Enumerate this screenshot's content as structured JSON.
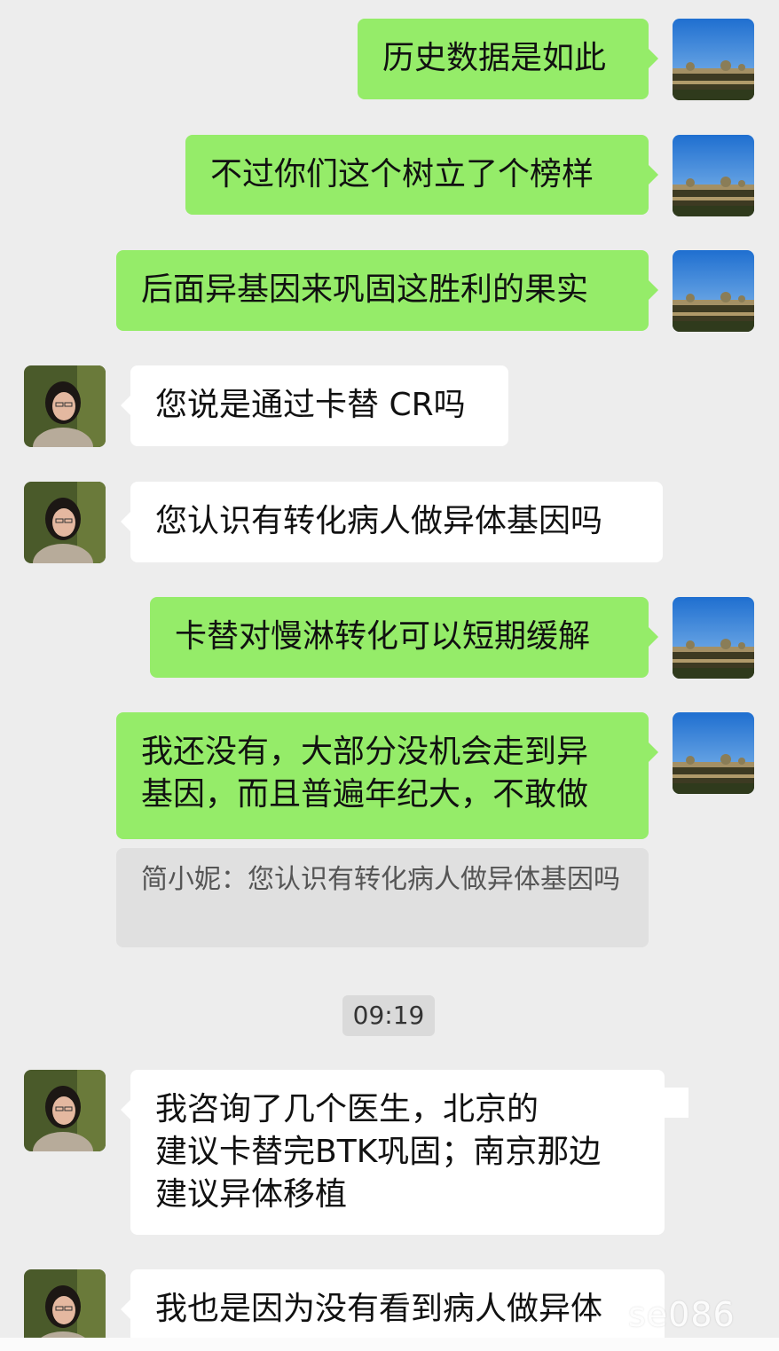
{
  "messages": [
    {
      "from": "me",
      "text": "历史数据是如此"
    },
    {
      "from": "me",
      "text": "不过你们这个树立了个榜样"
    },
    {
      "from": "me",
      "text": "后面异基因来巩固这胜利的果实"
    },
    {
      "from": "them",
      "text": "您说是通过卡替 CR吗"
    },
    {
      "from": "them",
      "text": "您认识有转化病人做异体基因吗"
    },
    {
      "from": "me",
      "text": "卡替对慢淋转化可以短期缓解"
    },
    {
      "from": "me",
      "lines": [
        "我还没有，大部分没机会走到异",
        "基因，而且普遍年纪大，不敢做"
      ]
    },
    {
      "from": "them",
      "lines": [
        "我咨询了几个医生，北京的",
        "建议卡替完BTK巩固；南京那边",
        "建议异体移植"
      ]
    },
    {
      "from": "them",
      "text": "我也是因为没有看到病人做异体"
    }
  ],
  "quote": {
    "text": "简小妮：您认识有转化病人做异体基因吗"
  },
  "timestamp": "09:19",
  "watermark": "se086",
  "colors": {
    "background": "#ededed",
    "my_bubble": "#95ec69",
    "their_bubble": "#ffffff",
    "quote_bg": "#e0e0e0"
  },
  "icons": {
    "my_avatar": "landscape-avatar",
    "their_avatar": "woman-portrait-avatar"
  }
}
